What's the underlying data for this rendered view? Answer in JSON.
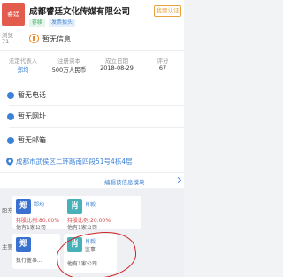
{
  "header": {
    "logo_text": "睿廷",
    "company_name": "成都睿廷文化传媒有限公司",
    "claim_button": "我要认证",
    "tags": [
      "存续",
      "发票抬头"
    ],
    "left_hint_1": "浏览",
    "left_hint_2": "71",
    "intro": "暂无信息"
  },
  "info": {
    "headers": [
      "法定代表人",
      "注册资本",
      "成立日期",
      "评分"
    ],
    "values": [
      "郑均",
      "500万人民币",
      "2018-08-29",
      "67"
    ]
  },
  "contacts": {
    "phone": "暂无电话",
    "website": "暂无网址",
    "email": "暂无邮箱",
    "address": "成都市武侯区二环路南四段51号4栋4层"
  },
  "edit_link": "编辑该信息模块",
  "shareholders": {
    "side_labels": [
      "股东",
      "主要人员"
    ],
    "cards": [
      {
        "avatar": "郑",
        "name": "郑均",
        "line1": "持股比例:80.00%",
        "line2": "他有1家公司"
      },
      {
        "avatar": "肖",
        "name": "肖毅",
        "line1": "持股比例:20.00%",
        "line2": "他有1家公司"
      },
      {
        "avatar": "郑",
        "name": "郑均",
        "line1": "执行董事...",
        "line2": ""
      },
      {
        "avatar": "肖",
        "name": "肖毅",
        "line1": "监事",
        "line2": "他有1家公司"
      }
    ]
  },
  "colors": {
    "accent": "#3e82d6",
    "warn": "#e9a23b",
    "highlight": "#cc2626"
  }
}
